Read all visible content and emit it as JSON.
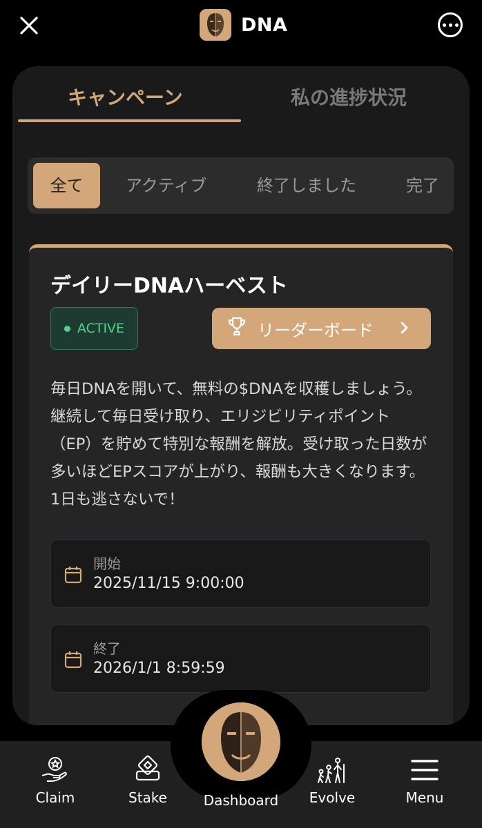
{
  "header": {
    "title": "DNA"
  },
  "tabs": [
    {
      "label": "キャンペーン",
      "active": true
    },
    {
      "label": "私の進捗状況",
      "active": false
    }
  ],
  "filters": [
    {
      "label": "全て",
      "selected": true
    },
    {
      "label": "アクティブ",
      "selected": false
    },
    {
      "label": "終了しました",
      "selected": false
    },
    {
      "label": "完了",
      "selected": false
    }
  ],
  "campaign": {
    "title": "デイリーDNAハーベスト",
    "status": "ACTIVE",
    "leaderboard_label": "リーダーボード",
    "description": "毎日DNAを開いて、無料の$DNAを収穫しましょう。 継続して毎日受け取り、エリジビリティポイント（EP）を貯めて特別な報酬を解放。受け取った日数が多いほどEPスコアが上がり、報酬も大きくなります。1日も逃さないで！",
    "start_label": "開始",
    "start_value": "2025/11/15 9:00:00",
    "end_label": "終了",
    "end_value": "2026/1/1 8:59:59"
  },
  "bottom_nav": {
    "claim": "Claim",
    "stake": "Stake",
    "dashboard": "Dashboard",
    "evolve": "Evolve",
    "menu": "Menu"
  },
  "colors": {
    "accent": "#d4a77a",
    "active_green": "#4fd18b",
    "panel": "#1a1a1a",
    "card": "#252525"
  },
  "icons": [
    "close-icon",
    "more-icon",
    "trophy-icon",
    "chevron-right-icon",
    "calendar-icon",
    "claim-icon",
    "stake-icon",
    "evolve-icon",
    "menu-icon"
  ]
}
